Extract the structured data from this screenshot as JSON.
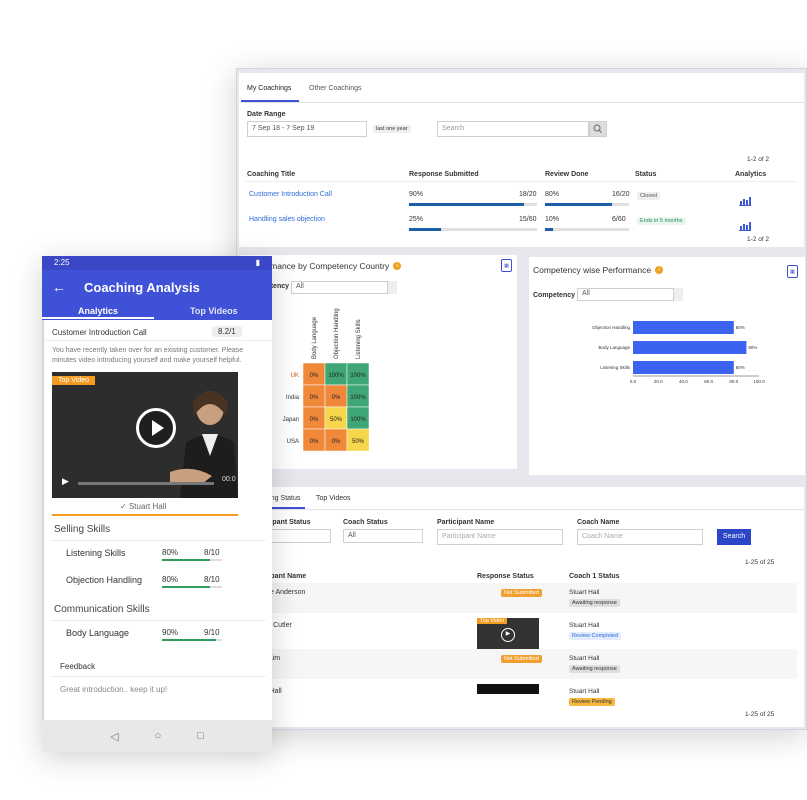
{
  "phone": {
    "status_time": "2:25",
    "title": "Coaching Analysis",
    "tabs": [
      "Analytics",
      "Top Videos"
    ],
    "call_title": "Customer Introduction Call",
    "score": "8.2/1",
    "description": "You have recently taken over for an existing customer. Please minutes video introducing yourself and make yourself helpful.",
    "top_video_tag": "Top Video",
    "video_time": "00:0",
    "reviewer": "Stuart Hall",
    "sections": [
      {
        "title": "Selling Skills",
        "skills": [
          {
            "name": "Listening Skills",
            "percent": "80%",
            "fraction": "8/10",
            "level": 0.8
          },
          {
            "name": "Objection Handling",
            "percent": "80%",
            "fraction": "8/10",
            "level": 0.8
          }
        ]
      },
      {
        "title": "Communication Skills",
        "skills": [
          {
            "name": "Body Language",
            "percent": "90%",
            "fraction": "9/10",
            "level": 0.9
          }
        ]
      }
    ],
    "feedback_label": "Feedback",
    "feedback_text": "Great introduction.. keep it up!"
  },
  "desk": {
    "tabs": [
      "My Coachings",
      "Other Coachings"
    ],
    "date_range_label": "Date Range",
    "date_range_value": "7 Sep 18 - 7 Sep 19",
    "date_chip": "last one year",
    "search_placeholder": "Search",
    "pager_top": "1-2 of 2",
    "pager_bottom": "1-2 of 2",
    "columns": [
      "Coaching Title",
      "Response Submitted",
      "Review Done",
      "Status",
      "Analytics"
    ],
    "rows": [
      {
        "title": "Customer Introduction Call",
        "resp_pct": "90%",
        "resp_frac": "18/20",
        "resp_level": 0.9,
        "rev_pct": "80%",
        "rev_frac": "16/20",
        "rev_level": 0.8,
        "status": "Closed"
      },
      {
        "title": "Handling sales objection",
        "resp_pct": "25%",
        "resp_frac": "15/60",
        "resp_level": 0.25,
        "rev_pct": "10%",
        "rev_frac": "6/60",
        "rev_level": 0.1,
        "status": "Ends in 5 months"
      }
    ],
    "perf_country_title": "Performance by Competency Country",
    "perf_comp_title": "Competency wise Performance",
    "competency_label": "Competency",
    "competency_value": "All",
    "lower_tabs": [
      "Coaching Status",
      "Top Videos"
    ],
    "filters": {
      "participant_status_label": "Participant Status",
      "participant_status_value": "All",
      "coach_status_label": "Coach Status",
      "coach_status_value": "All",
      "participant_name_label": "Participant Name",
      "participant_name_placeholder": "Participant Name",
      "coach_name_label": "Coach Name",
      "coach_name_placeholder": "Coach Name",
      "search_button": "Search"
    },
    "pager2_top": "1-25 of 25",
    "pager2_bottom": "1-25 of 25",
    "columns2": [
      "Participant Name",
      "Response Status",
      "Coach 1 Status"
    ],
    "rows2": [
      {
        "name": "Maurice Anderson",
        "response": "Not Submitted",
        "coach": "Stuart Hall",
        "coach_status": "Awaiting response"
      },
      {
        "name": "Helene Cutler",
        "response": "Top Video",
        "coach": "Stuart Hall",
        "coach_status": "Review Completed"
      },
      {
        "name": "Xiong Lim",
        "response": "Not Submitted",
        "coach": "Stuart Hall",
        "coach_status": "Awaiting response"
      },
      {
        "name": "Stuart Hall",
        "response": "",
        "coach": "Stuart Hall",
        "coach_status": "Review Pending"
      }
    ]
  },
  "chart_data": [
    {
      "type": "heatmap",
      "title": "Performance by Competency Country",
      "x_categories": [
        "Body Language",
        "Objection Handling",
        "Listening Skills"
      ],
      "y_categories": [
        "UK",
        "India",
        "Japan",
        "USA"
      ],
      "values": [
        [
          0,
          100,
          100
        ],
        [
          0,
          0,
          100
        ],
        [
          0,
          50,
          100
        ],
        [
          0,
          0,
          50
        ]
      ],
      "labels": [
        [
          "0%",
          "100%",
          "100%"
        ],
        [
          "0%",
          "0%",
          "100%"
        ],
        [
          "0%",
          "50%",
          "100%"
        ],
        [
          "0%",
          "0%",
          "50%"
        ]
      ],
      "colors": {
        "low": "#f0883a",
        "mid": "#f6d64a",
        "high": "#3fa776"
      }
    },
    {
      "type": "bar",
      "orientation": "horizontal",
      "title": "Competency wise Performance",
      "categories": [
        "Objection Handling",
        "Body Language",
        "Listening Skills"
      ],
      "values": [
        80,
        90,
        80
      ],
      "labels": [
        "80%",
        "90%",
        "80%"
      ],
      "xlim": [
        0,
        100
      ],
      "ticks": [
        "0.0",
        "20.0",
        "40.0",
        "60.0",
        "80.0",
        "100.0"
      ],
      "color": "#3b63f0"
    }
  ]
}
